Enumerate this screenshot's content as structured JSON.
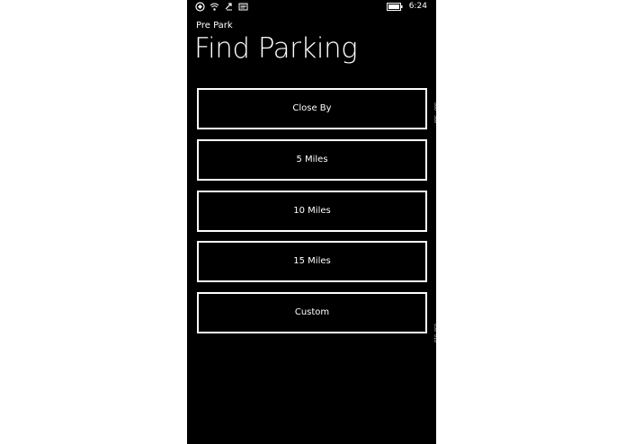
{
  "status_bar": {
    "time": "6:24",
    "icons": [
      "tile-icon",
      "signal-wifi-icon",
      "data-sync-icon",
      "message-icon"
    ],
    "right_icons": [
      "battery-icon"
    ]
  },
  "header": {
    "app_name": "Pre Park",
    "page_title": "Find Parking"
  },
  "buttons": [
    {
      "label": "Close By"
    },
    {
      "label": "5 Miles"
    },
    {
      "label": "10 Miles"
    },
    {
      "label": "15 Miles"
    },
    {
      "label": "Custom"
    }
  ],
  "scroll_markers": {
    "top_a": "000",
    "top_b": "500",
    "bottom_a": "050",
    "bottom_b": "010",
    "bottom_c": "010"
  },
  "colors": {
    "background": "#000000",
    "foreground": "#ffffff",
    "page_outer": "#ffffff"
  }
}
